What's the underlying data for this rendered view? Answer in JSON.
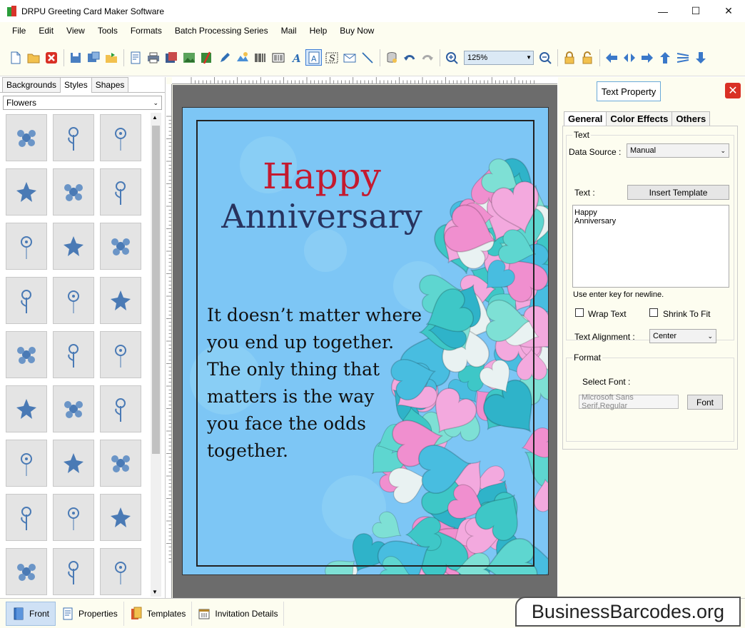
{
  "window": {
    "title": "DRPU Greeting Card Maker Software",
    "minimize": "—",
    "maximize": "☐",
    "close": "✕"
  },
  "menu": [
    "File",
    "Edit",
    "View",
    "Tools",
    "Formats",
    "Batch Processing Series",
    "Mail",
    "Help",
    "Buy Now"
  ],
  "toolbar": {
    "zoom": "125%"
  },
  "left_panel": {
    "tabs": [
      "Backgrounds",
      "Styles",
      "Shapes"
    ],
    "active_tab": "Styles",
    "category": "Flowers"
  },
  "card": {
    "title_line1": "Happy",
    "title_line2": "Anniversary",
    "quote": [
      "It doesn’t matter where",
      "you end up together.",
      "The only thing that",
      "matters is the way",
      "you face the odds",
      "together."
    ]
  },
  "text_property": {
    "title": "Text Property",
    "tabs": [
      "General",
      "Color Effects",
      "Others"
    ],
    "active_tab": "General",
    "text_group_label": "Text",
    "data_source_label": "Data Source :",
    "data_source_value": "Manual",
    "text_label": "Text :",
    "insert_template": "Insert Template",
    "text_value": "Happy\nAnniversary",
    "hint": "Use enter key for newline.",
    "wrap_text": "Wrap Text",
    "shrink_to_fit": "Shrink To Fit",
    "alignment_label": "Text Alignment :",
    "alignment_value": "Center",
    "format_group_label": "Format",
    "select_font_label": "Select Font :",
    "font_value": "Microsoft Sans Serif,Regular",
    "font_button": "Font"
  },
  "bottom_tabs": [
    {
      "label": "Front",
      "active": true
    },
    {
      "label": "Properties",
      "active": false
    },
    {
      "label": "Templates",
      "active": false
    },
    {
      "label": "Invitation Details",
      "active": false
    }
  ],
  "watermark": "BusinessBarcodes.org",
  "colors": {
    "title_red": "#c41a2f",
    "title_navy": "#28335e",
    "card_blue": "#7dc6f5",
    "accent_blue": "#3a7bd5"
  }
}
